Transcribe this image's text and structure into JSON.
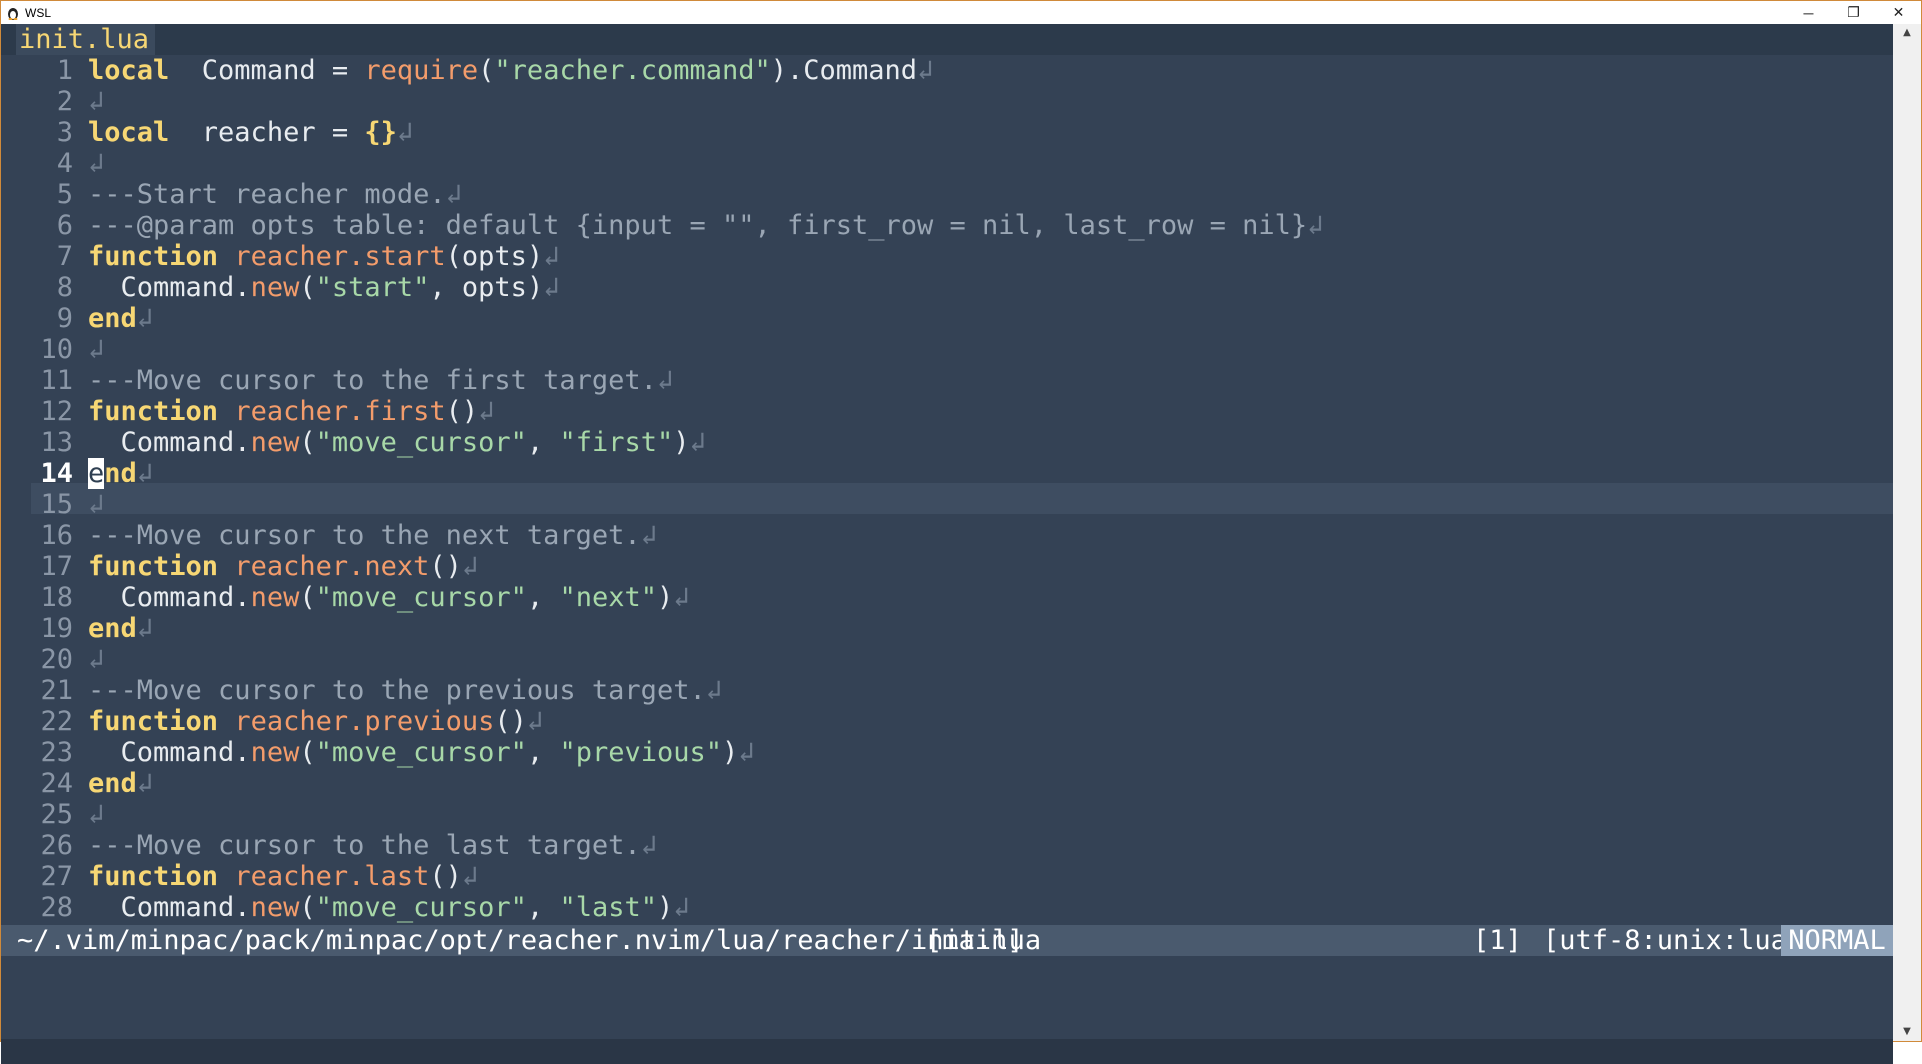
{
  "window": {
    "title": "WSL",
    "minimize": "─",
    "restore": "❐",
    "close": "✕"
  },
  "tab": {
    "label": "init.lua"
  },
  "cursor_line": "14",
  "lines": [
    {
      "n": "1",
      "segs": [
        [
          "kw",
          "local"
        ],
        [
          "",
          "  Command "
        ],
        [
          "",
          "= "
        ],
        [
          "fn",
          "require"
        ],
        [
          "",
          "("
        ],
        [
          "str",
          "\"reacher.command\""
        ],
        [
          "",
          ").Command"
        ],
        [
          "eol",
          "↲"
        ]
      ]
    },
    {
      "n": "2",
      "segs": [
        [
          "eol",
          "↲"
        ]
      ]
    },
    {
      "n": "3",
      "segs": [
        [
          "kw",
          "local"
        ],
        [
          "",
          "  reacher = "
        ],
        [
          "br",
          "{}"
        ],
        [
          "eol",
          "↲"
        ]
      ]
    },
    {
      "n": "4",
      "segs": [
        [
          "eol",
          "↲"
        ]
      ]
    },
    {
      "n": "5",
      "segs": [
        [
          "com",
          "---Start reacher mode."
        ],
        [
          "eol",
          "↲"
        ]
      ]
    },
    {
      "n": "6",
      "segs": [
        [
          "com",
          "---@param opts table: default {input = \"\", first_row = nil, last_row = nil}"
        ],
        [
          "eol",
          "↲"
        ]
      ]
    },
    {
      "n": "7",
      "segs": [
        [
          "kw",
          "function"
        ],
        [
          "",
          " "
        ],
        [
          "fn",
          "reacher.start"
        ],
        [
          "",
          "(opts)"
        ],
        [
          "eol",
          "↲"
        ]
      ]
    },
    {
      "n": "8",
      "segs": [
        [
          "",
          "  Command."
        ],
        [
          "fn",
          "new"
        ],
        [
          "",
          "("
        ],
        [
          "str",
          "\"start\""
        ],
        [
          "",
          ", opts)"
        ],
        [
          "eol",
          "↲"
        ]
      ]
    },
    {
      "n": "9",
      "segs": [
        [
          "kw",
          "end"
        ],
        [
          "eol",
          "↲"
        ]
      ]
    },
    {
      "n": "10",
      "segs": [
        [
          "eol",
          "↲"
        ]
      ]
    },
    {
      "n": "11",
      "segs": [
        [
          "com",
          "---Move cursor to the first target."
        ],
        [
          "eol",
          "↲"
        ]
      ]
    },
    {
      "n": "12",
      "segs": [
        [
          "kw",
          "function"
        ],
        [
          "",
          " "
        ],
        [
          "fn",
          "reacher.first"
        ],
        [
          "",
          "()"
        ],
        [
          "eol",
          "↲"
        ]
      ]
    },
    {
      "n": "13",
      "segs": [
        [
          "",
          "  Command."
        ],
        [
          "fn",
          "new"
        ],
        [
          "",
          "("
        ],
        [
          "str",
          "\"move_cursor\""
        ],
        [
          "",
          ", "
        ],
        [
          "str",
          "\"first\""
        ],
        [
          "",
          ")"
        ],
        [
          "eol",
          "↲"
        ]
      ]
    },
    {
      "n": "14",
      "segs": [
        [
          "cursor",
          "e"
        ],
        [
          "kw",
          "nd"
        ],
        [
          "eol",
          "↲"
        ]
      ]
    },
    {
      "n": "15",
      "segs": [
        [
          "eol",
          "↲"
        ]
      ]
    },
    {
      "n": "16",
      "segs": [
        [
          "com",
          "---Move cursor to the next target."
        ],
        [
          "eol",
          "↲"
        ]
      ]
    },
    {
      "n": "17",
      "segs": [
        [
          "kw",
          "function"
        ],
        [
          "",
          " "
        ],
        [
          "fn",
          "reacher.next"
        ],
        [
          "",
          "()"
        ],
        [
          "eol",
          "↲"
        ]
      ]
    },
    {
      "n": "18",
      "segs": [
        [
          "",
          "  Command."
        ],
        [
          "fn",
          "new"
        ],
        [
          "",
          "("
        ],
        [
          "str",
          "\"move_cursor\""
        ],
        [
          "",
          ", "
        ],
        [
          "str",
          "\"next\""
        ],
        [
          "",
          ")"
        ],
        [
          "eol",
          "↲"
        ]
      ]
    },
    {
      "n": "19",
      "segs": [
        [
          "kw",
          "end"
        ],
        [
          "eol",
          "↲"
        ]
      ]
    },
    {
      "n": "20",
      "segs": [
        [
          "eol",
          "↲"
        ]
      ]
    },
    {
      "n": "21",
      "segs": [
        [
          "com",
          "---Move cursor to the previous target."
        ],
        [
          "eol",
          "↲"
        ]
      ]
    },
    {
      "n": "22",
      "segs": [
        [
          "kw",
          "function"
        ],
        [
          "",
          " "
        ],
        [
          "fn",
          "reacher.previous"
        ],
        [
          "",
          "()"
        ],
        [
          "eol",
          "↲"
        ]
      ]
    },
    {
      "n": "23",
      "segs": [
        [
          "",
          "  Command."
        ],
        [
          "fn",
          "new"
        ],
        [
          "",
          "("
        ],
        [
          "str",
          "\"move_cursor\""
        ],
        [
          "",
          ", "
        ],
        [
          "str",
          "\"previous\""
        ],
        [
          "",
          ")"
        ],
        [
          "eol",
          "↲"
        ]
      ]
    },
    {
      "n": "24",
      "segs": [
        [
          "kw",
          "end"
        ],
        [
          "eol",
          "↲"
        ]
      ]
    },
    {
      "n": "25",
      "segs": [
        [
          "eol",
          "↲"
        ]
      ]
    },
    {
      "n": "26",
      "segs": [
        [
          "com",
          "---Move cursor to the last target."
        ],
        [
          "eol",
          "↲"
        ]
      ]
    },
    {
      "n": "27",
      "segs": [
        [
          "kw",
          "function"
        ],
        [
          "",
          " "
        ],
        [
          "fn",
          "reacher.last"
        ],
        [
          "",
          "()"
        ],
        [
          "eol",
          "↲"
        ]
      ]
    },
    {
      "n": "28",
      "segs": [
        [
          "",
          "  Command."
        ],
        [
          "fn",
          "new"
        ],
        [
          "",
          "("
        ],
        [
          "str",
          "\"move_cursor\""
        ],
        [
          "",
          ", "
        ],
        [
          "str",
          "\"last\""
        ],
        [
          "",
          ")"
        ],
        [
          "eol",
          "↲"
        ]
      ]
    }
  ],
  "statusline": {
    "path": "~/.vim/minpac/pack/minpac/opt/reacher.nvim/lua/reacher/init.lua",
    "branch": "[main]",
    "buffer": "[1]",
    "encoding": "[utf-8:unix:lua]",
    "mode": "NORMAL"
  },
  "colors": {
    "keyword": "#f7d774",
    "function": "#f39c6b",
    "string": "#a8d8a8",
    "comment": "#9aa6b4",
    "background": "#344255",
    "mode_bg": "#8fa3ba"
  },
  "scrollbar": {
    "up_icon": "arrow-up-icon",
    "down_icon": "arrow-down-icon"
  }
}
